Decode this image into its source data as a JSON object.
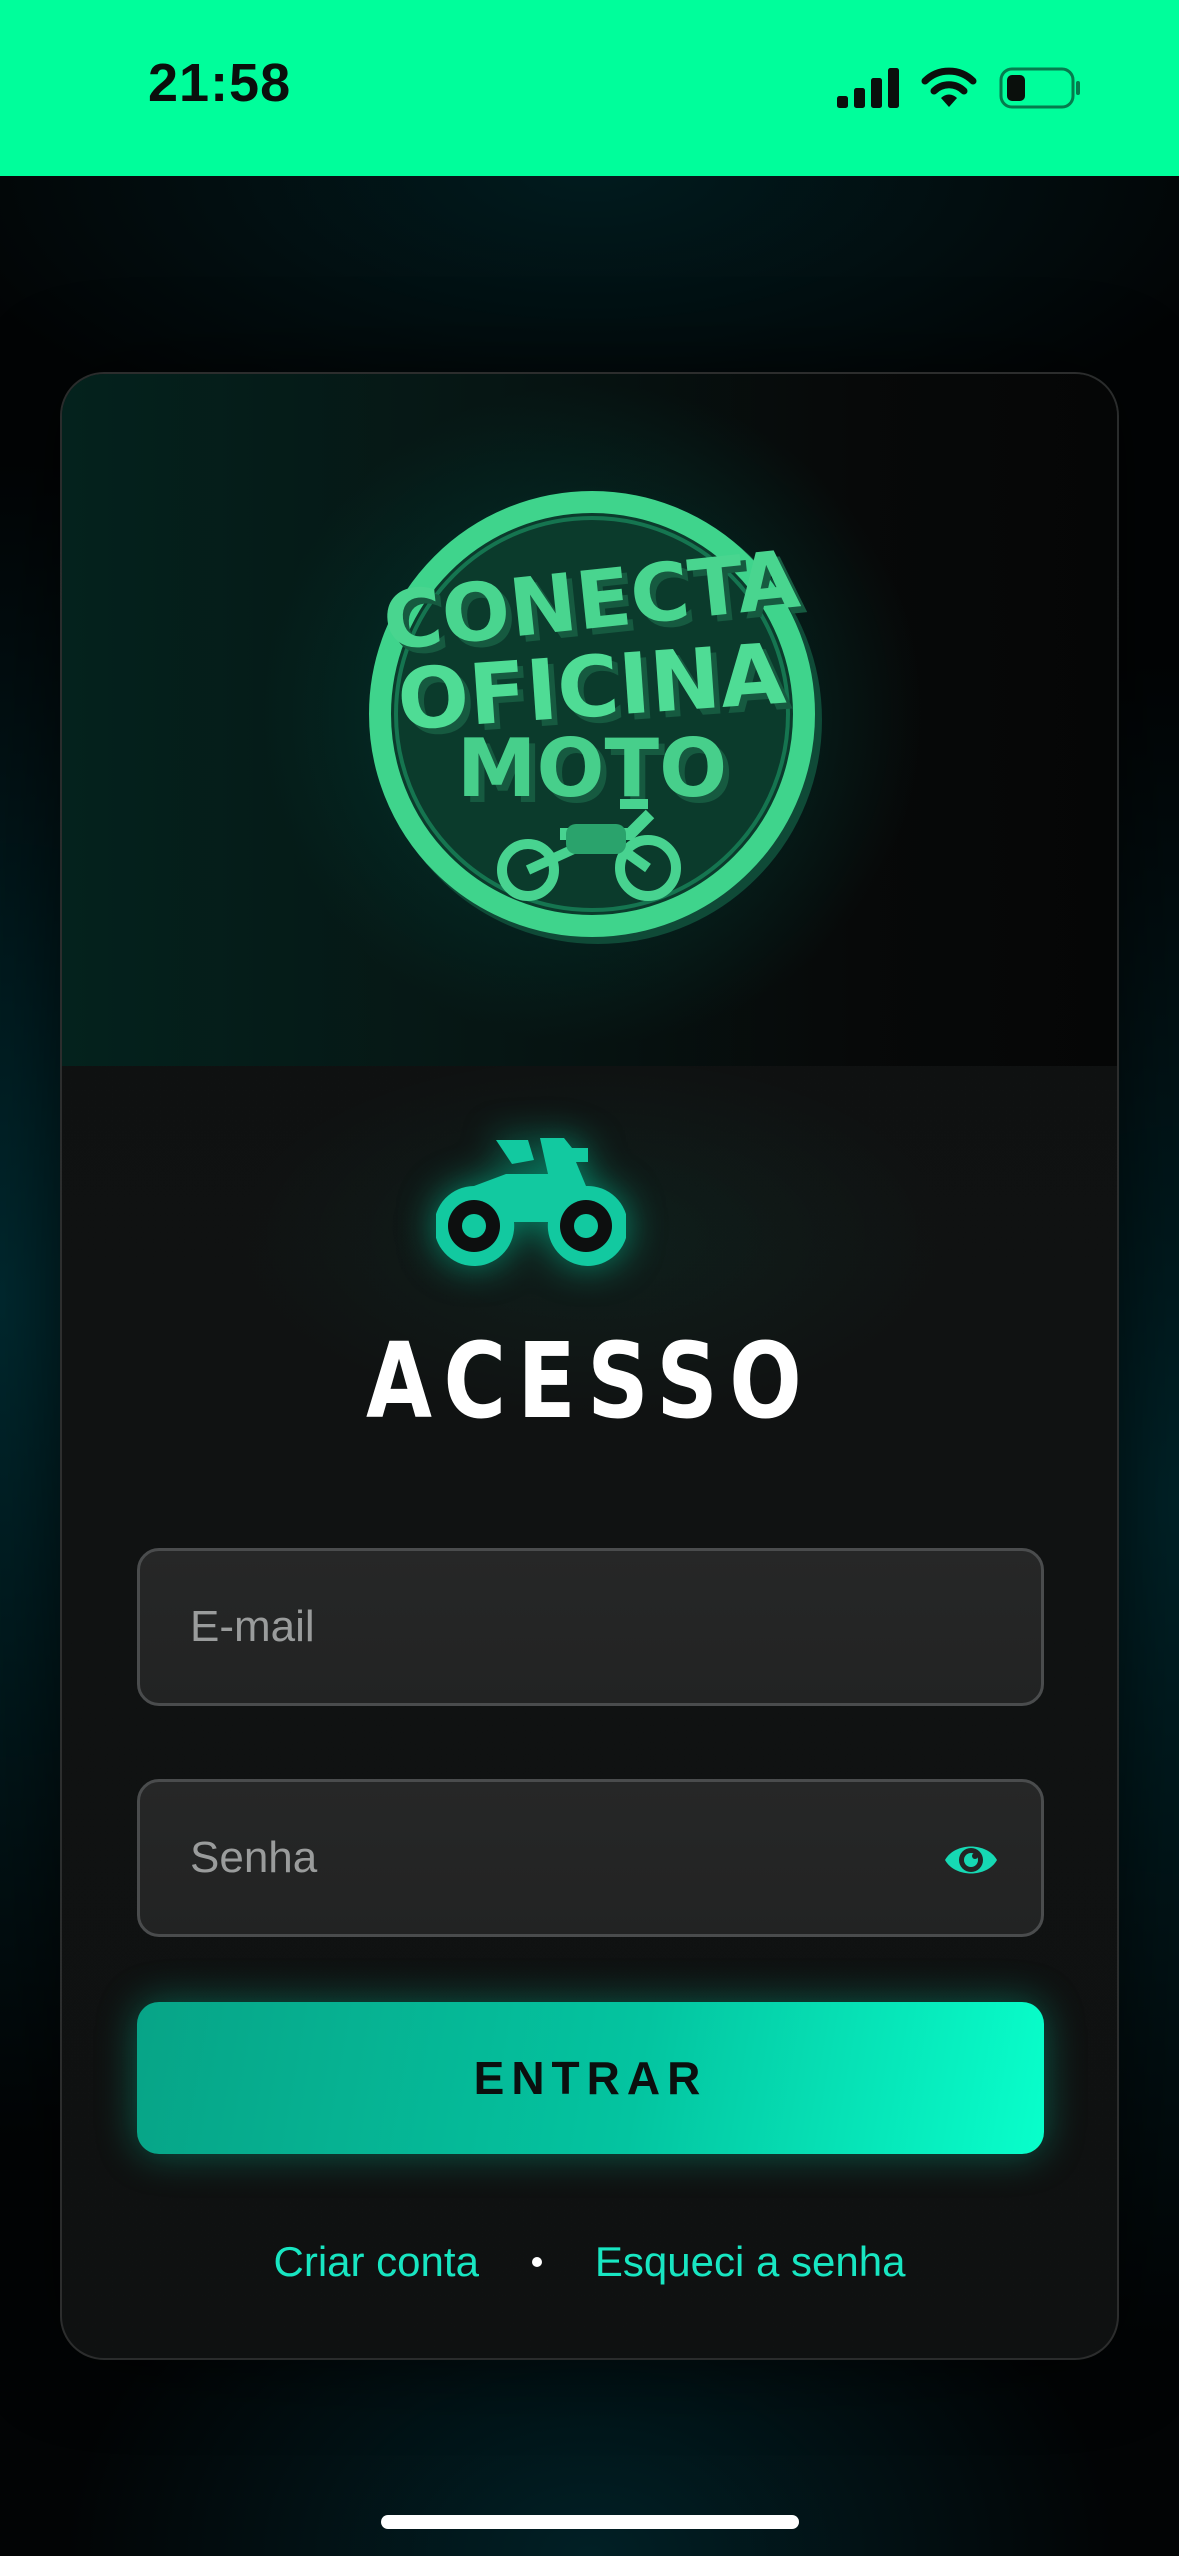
{
  "status_bar": {
    "time": "21:58",
    "icons": [
      "signal-icon",
      "wifi-icon",
      "battery-icon"
    ]
  },
  "logo": {
    "lines": [
      "CONECTA",
      "OFICINA",
      "MOTO"
    ],
    "icon": "motorcycle-icon"
  },
  "login": {
    "icon": "motorcycle-icon",
    "title": "ACESSO",
    "email_placeholder": "E-mail",
    "password_placeholder": "Senha",
    "password_toggle_icon": "eye-icon",
    "submit_label": "ENTRAR",
    "create_account_label": "Criar conta",
    "forgot_password_label": "Esqueci a senha"
  },
  "colors": {
    "status_bar_bg": "#00fe9b",
    "accent": "#18e6c2",
    "button_gradient_start": "#07a487",
    "button_gradient_end": "#08ffcb"
  }
}
